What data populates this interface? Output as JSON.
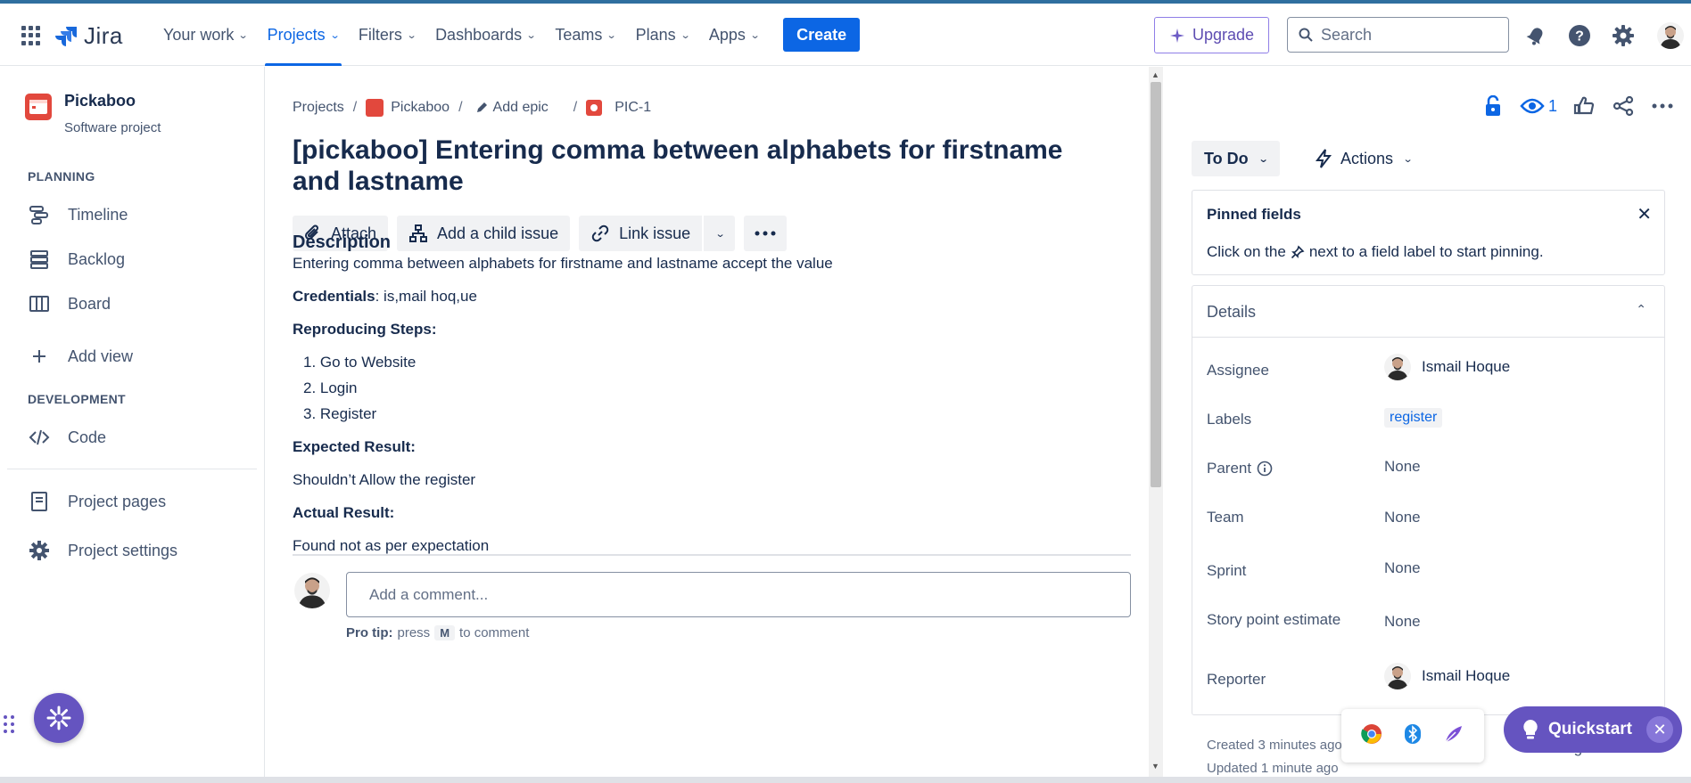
{
  "nav": {
    "logo": "Jira",
    "items": [
      {
        "label": "Your work"
      },
      {
        "label": "Projects"
      },
      {
        "label": "Filters"
      },
      {
        "label": "Dashboards"
      },
      {
        "label": "Teams"
      },
      {
        "label": "Plans"
      },
      {
        "label": "Apps"
      }
    ],
    "active_index": 1,
    "create_label": "Create",
    "upgrade_label": "Upgrade",
    "search_placeholder": "Search"
  },
  "sidebar": {
    "project_name": "Pickaboo",
    "project_type": "Software project",
    "planning_heading": "PLANNING",
    "planning_items": [
      {
        "label": "Timeline",
        "icon": "timeline-icon"
      },
      {
        "label": "Backlog",
        "icon": "backlog-icon"
      },
      {
        "label": "Board",
        "icon": "board-icon"
      }
    ],
    "add_view_label": "Add view",
    "development_heading": "DEVELOPMENT",
    "code_label": "Code",
    "project_pages_label": "Project pages",
    "project_settings_label": "Project settings"
  },
  "breadcrumb": {
    "projects": "Projects",
    "project": "Pickaboo",
    "epic": "Add epic",
    "issue_key": "PIC-1"
  },
  "issue": {
    "title": "[pickaboo] Entering comma between alphabets for firstname and lastname",
    "actions": {
      "attach": "Attach",
      "child": "Add a child issue",
      "link": "Link issue"
    },
    "description_heading": "Description",
    "description_text": " Entering comma between alphabets for firstname and lastname accept the value",
    "credentials_label": "Credentials",
    "credentials_value": ": is,mail  hoq,ue",
    "steps_heading": "Reproducing Steps:",
    "steps": [
      "1. Go to Website",
      "2. Login",
      "3. Register"
    ],
    "expected_heading": "Expected Result:",
    "expected_text": "Shouldn’t Allow the register",
    "actual_heading": "Actual Result:",
    "actual_text": "Found not as per expectation"
  },
  "comment": {
    "placeholder": "Add a comment...",
    "tip_label": "Pro tip:",
    "tip_press": "press",
    "tip_key": "M",
    "tip_rest": "to comment"
  },
  "right_panel": {
    "watch_count": "1",
    "status": "To Do",
    "actions_label": "Actions",
    "pinned_title": "Pinned fields",
    "pinned_text_before": "Click on the",
    "pinned_text_after": "next to a field label to start pinning.",
    "details_title": "Details",
    "fields": {
      "assignee_label": "Assignee",
      "assignee_value": "Ismail Hoque",
      "labels_label": "Labels",
      "labels_value": "register",
      "parent_label": "Parent",
      "parent_value": "None",
      "team_label": "Team",
      "team_value": "None",
      "sprint_label": "Sprint",
      "sprint_value": "None",
      "story_label": "Story point estimate",
      "story_value": "None",
      "reporter_label": "Reporter",
      "reporter_value": "Ismail Hoque"
    },
    "created": "Created 3 minutes ago",
    "updated": "Updated 1 minute ago",
    "configure": "Configure"
  },
  "quickstart_label": "Quickstart",
  "colors": {
    "brand": "#0c66e4",
    "purple": "#6554c0",
    "project_icon": "#e2483d"
  }
}
